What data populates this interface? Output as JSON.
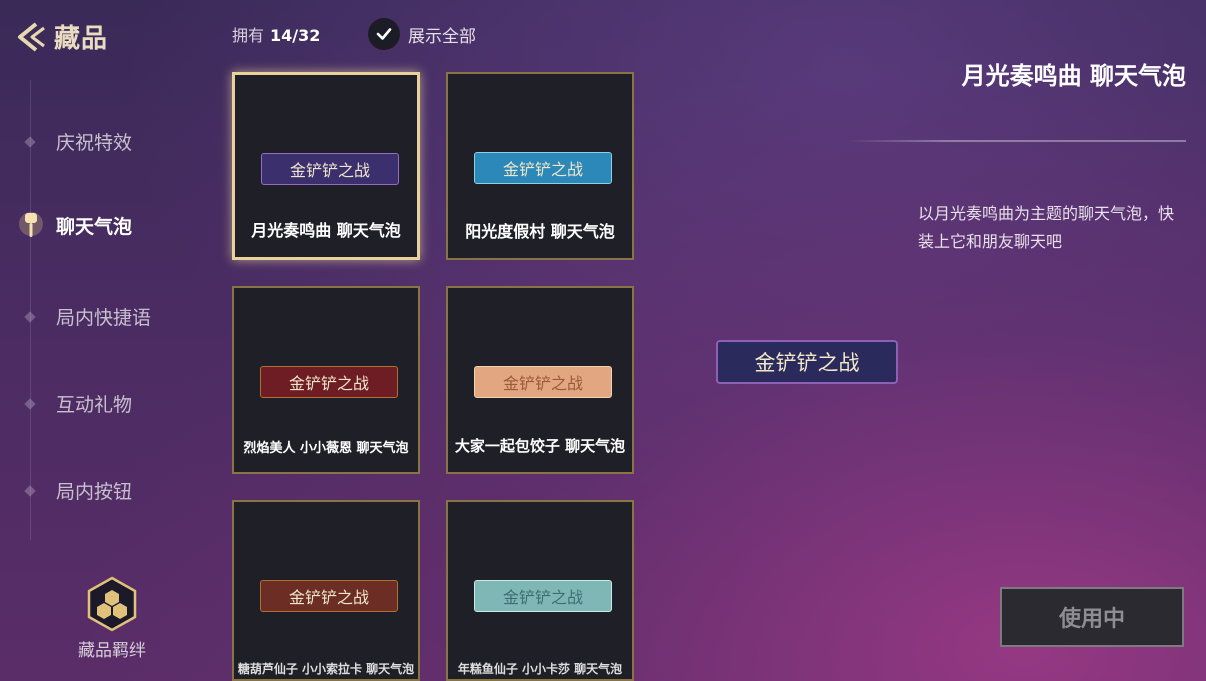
{
  "header": {
    "title": "藏品"
  },
  "sidebar": {
    "items": [
      {
        "label": "庆祝特效"
      },
      {
        "label": "聊天气泡"
      },
      {
        "label": "局内快捷语"
      },
      {
        "label": "互动礼物"
      },
      {
        "label": "局内按钮"
      }
    ],
    "bonds_label": "藏品羁绊"
  },
  "toolbar": {
    "owned_label": "拥有",
    "owned_count": "14/32",
    "show_all_label": "展示全部"
  },
  "cards": [
    {
      "bubble_text": "金铲铲之战",
      "name": "月光奏鸣曲 聊天气泡",
      "bubble_color": "#3b2f6e"
    },
    {
      "bubble_text": "金铲铲之战",
      "name": "阳光度假村 聊天气泡",
      "bubble_color": "#2c88b8"
    },
    {
      "bubble_text": "金铲铲之战",
      "name": "烈焰美人 小小薇恩 聊天气泡",
      "bubble_color": "#6e1d24"
    },
    {
      "bubble_text": "金铲铲之战",
      "name": "大家一起包饺子 聊天气泡",
      "bubble_color": "#e2a681"
    },
    {
      "bubble_text": "金铲铲之战",
      "name": "糖葫芦仙子 小小索拉卡 聊天气泡",
      "bubble_color": "#6b2d24"
    },
    {
      "bubble_text": "金铲铲之战",
      "name": "年糕鱼仙子 小小卡莎 聊天气泡",
      "bubble_color": "#7fb7b6"
    }
  ],
  "detail": {
    "title": "月光奏鸣曲 聊天气泡",
    "description": "以月光奏鸣曲为主题的聊天气泡，快装上它和朋友聊天吧",
    "preview_text": "金铲铲之战",
    "use_button": "使用中"
  },
  "icons": {
    "back": "back-arrow-icon",
    "check": "check-icon",
    "active_nav": "spatula-icon",
    "bonds": "hexagon-bonds-icon"
  }
}
